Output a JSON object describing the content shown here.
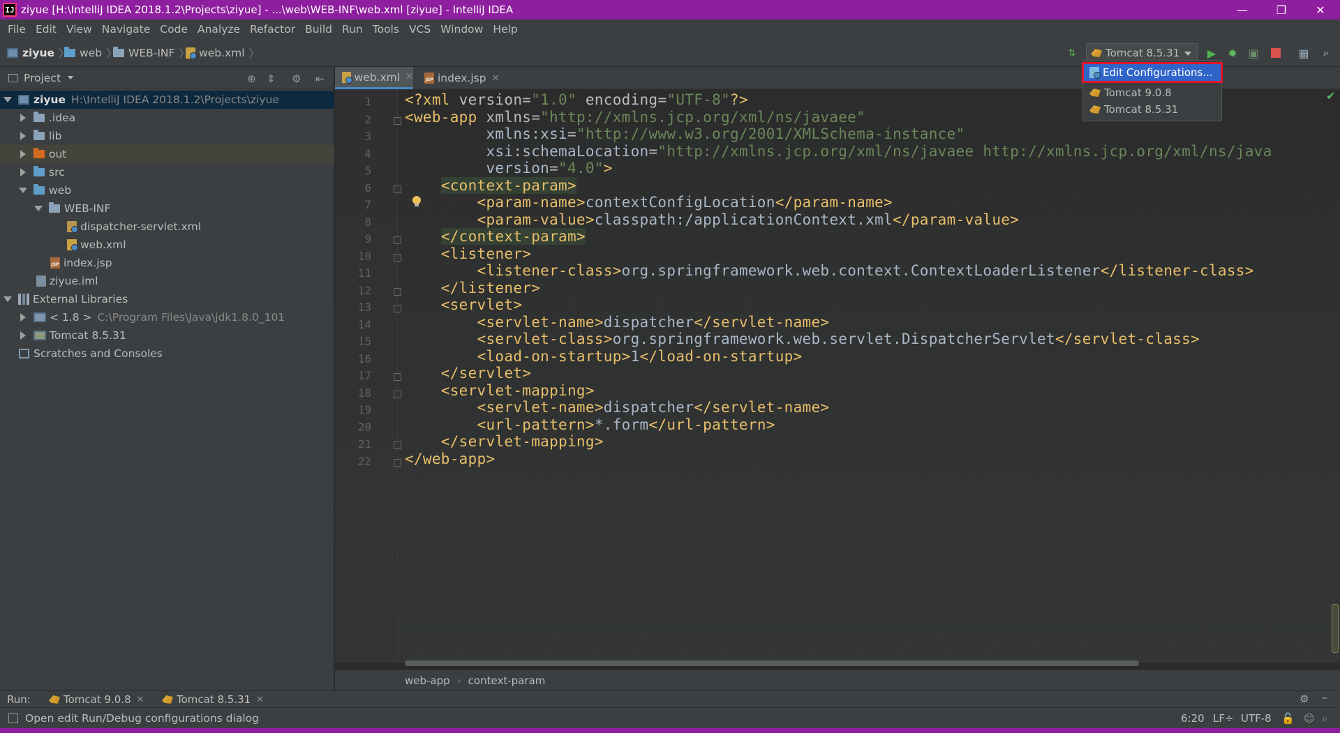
{
  "window": {
    "title": "ziyue [H:\\IntelliJ IDEA 2018.1.2\\Projects\\ziyue] - ...\\web\\WEB-INF\\web.xml [ziyue] - IntelliJ IDEA",
    "app_icon_text": "IJ",
    "controls": {
      "minimize": "—",
      "restore": "❐",
      "close": "✕"
    }
  },
  "menu": [
    "File",
    "Edit",
    "View",
    "Navigate",
    "Code",
    "Analyze",
    "Refactor",
    "Build",
    "Run",
    "Tools",
    "VCS",
    "Window",
    "Help"
  ],
  "navbar": {
    "crumbs": [
      "ziyue",
      "web",
      "WEB-INF",
      "web.xml"
    ],
    "run_config": "Tomcat 8.5.31"
  },
  "run_config_menu": {
    "items": [
      "Edit Configurations...",
      "Tomcat 9.0.8",
      "Tomcat 8.5.31"
    ],
    "selected": "Edit Configurations..."
  },
  "project_panel": {
    "title": "Project",
    "tree": [
      {
        "label": "ziyue",
        "detail": "H:\\IntelliJ IDEA 2018.1.2\\Projects\\ziyue",
        "icon": "module-icon",
        "expanded": true
      },
      {
        "label": ".idea",
        "icon": "folder-icon",
        "expanded": false
      },
      {
        "label": "lib",
        "icon": "folder-icon",
        "expanded": false
      },
      {
        "label": "out",
        "icon": "excluded-folder-icon",
        "expanded": false
      },
      {
        "label": "src",
        "icon": "source-folder-icon",
        "expanded": false
      },
      {
        "label": "web",
        "icon": "web-folder-icon",
        "expanded": true
      },
      {
        "label": "WEB-INF",
        "icon": "folder-icon",
        "expanded": true
      },
      {
        "label": "dispatcher-servlet.xml",
        "icon": "spring-xml-icon"
      },
      {
        "label": "web.xml",
        "icon": "web-xml-icon"
      },
      {
        "label": "index.jsp",
        "icon": "jsp-file-icon"
      },
      {
        "label": "ziyue.iml",
        "icon": "iml-file-icon"
      },
      {
        "label": "External Libraries",
        "icon": "library-icon",
        "expanded": true
      },
      {
        "label": "< 1.8 >",
        "detail": "C:\\Program Files\\Java\\jdk1.8.0_101",
        "icon": "jdk-icon",
        "expanded": false
      },
      {
        "label": "Tomcat 8.5.31",
        "icon": "tomcat-library-icon",
        "expanded": false
      },
      {
        "label": "Scratches and Consoles",
        "icon": "scratches-icon"
      }
    ]
  },
  "editor": {
    "tabs": [
      {
        "label": "web.xml",
        "active": true
      },
      {
        "label": "index.jsp",
        "active": false
      }
    ],
    "line_numbers": [
      "1",
      "2",
      "3",
      "4",
      "5",
      "6",
      "7",
      "8",
      "9",
      "10",
      "11",
      "12",
      "13",
      "14",
      "15",
      "16",
      "17",
      "18",
      "19",
      "20",
      "21",
      "22"
    ],
    "lines": [
      "<?xml version=\"1.0\" encoding=\"UTF-8\"?>",
      "<web-app xmlns=\"http://xmlns.jcp.org/xml/ns/javaee\"",
      "         xmlns:xsi=\"http://www.w3.org/2001/XMLSchema-instance\"",
      "         xsi:schemaLocation=\"http://xmlns.jcp.org/xml/ns/javaee http://xmlns.jcp.org/xml/ns/java",
      "         version=\"4.0\">",
      "    <context-param>",
      "        <param-name>contextConfigLocation</param-name>",
      "        <param-value>classpath:/applicationContext.xml</param-value>",
      "    </context-param>",
      "    <listener>",
      "        <listener-class>org.springframework.web.context.ContextLoaderListener</listener-class>",
      "    </listener>",
      "    <servlet>",
      "        <servlet-name>dispatcher</servlet-name>",
      "        <servlet-class>org.springframework.web.servlet.DispatcherServlet</servlet-class>",
      "        <load-on-startup>1</load-on-startup>",
      "    </servlet>",
      "    <servlet-mapping>",
      "        <servlet-name>dispatcher</servlet-name>",
      "        <url-pattern>*.form</url-pattern>",
      "    </servlet-mapping>",
      "</web-app>"
    ],
    "breadcrumbs": [
      "web-app",
      "context-param"
    ]
  },
  "run_bar": {
    "label": "Run:",
    "tabs": [
      "Tomcat 9.0.8",
      "Tomcat 8.5.31"
    ]
  },
  "status_bar": {
    "message": "Open edit Run/Debug configurations dialog",
    "position": "6:20",
    "line_separator": "LF÷",
    "encoding": "UTF-8"
  },
  "colors": {
    "title_bar": "#8e1f9e",
    "selection": "#2f65ca",
    "highlight_border": "#e0162b",
    "xml_tag": "#e8bf6a",
    "xml_value": "#6a8759"
  }
}
